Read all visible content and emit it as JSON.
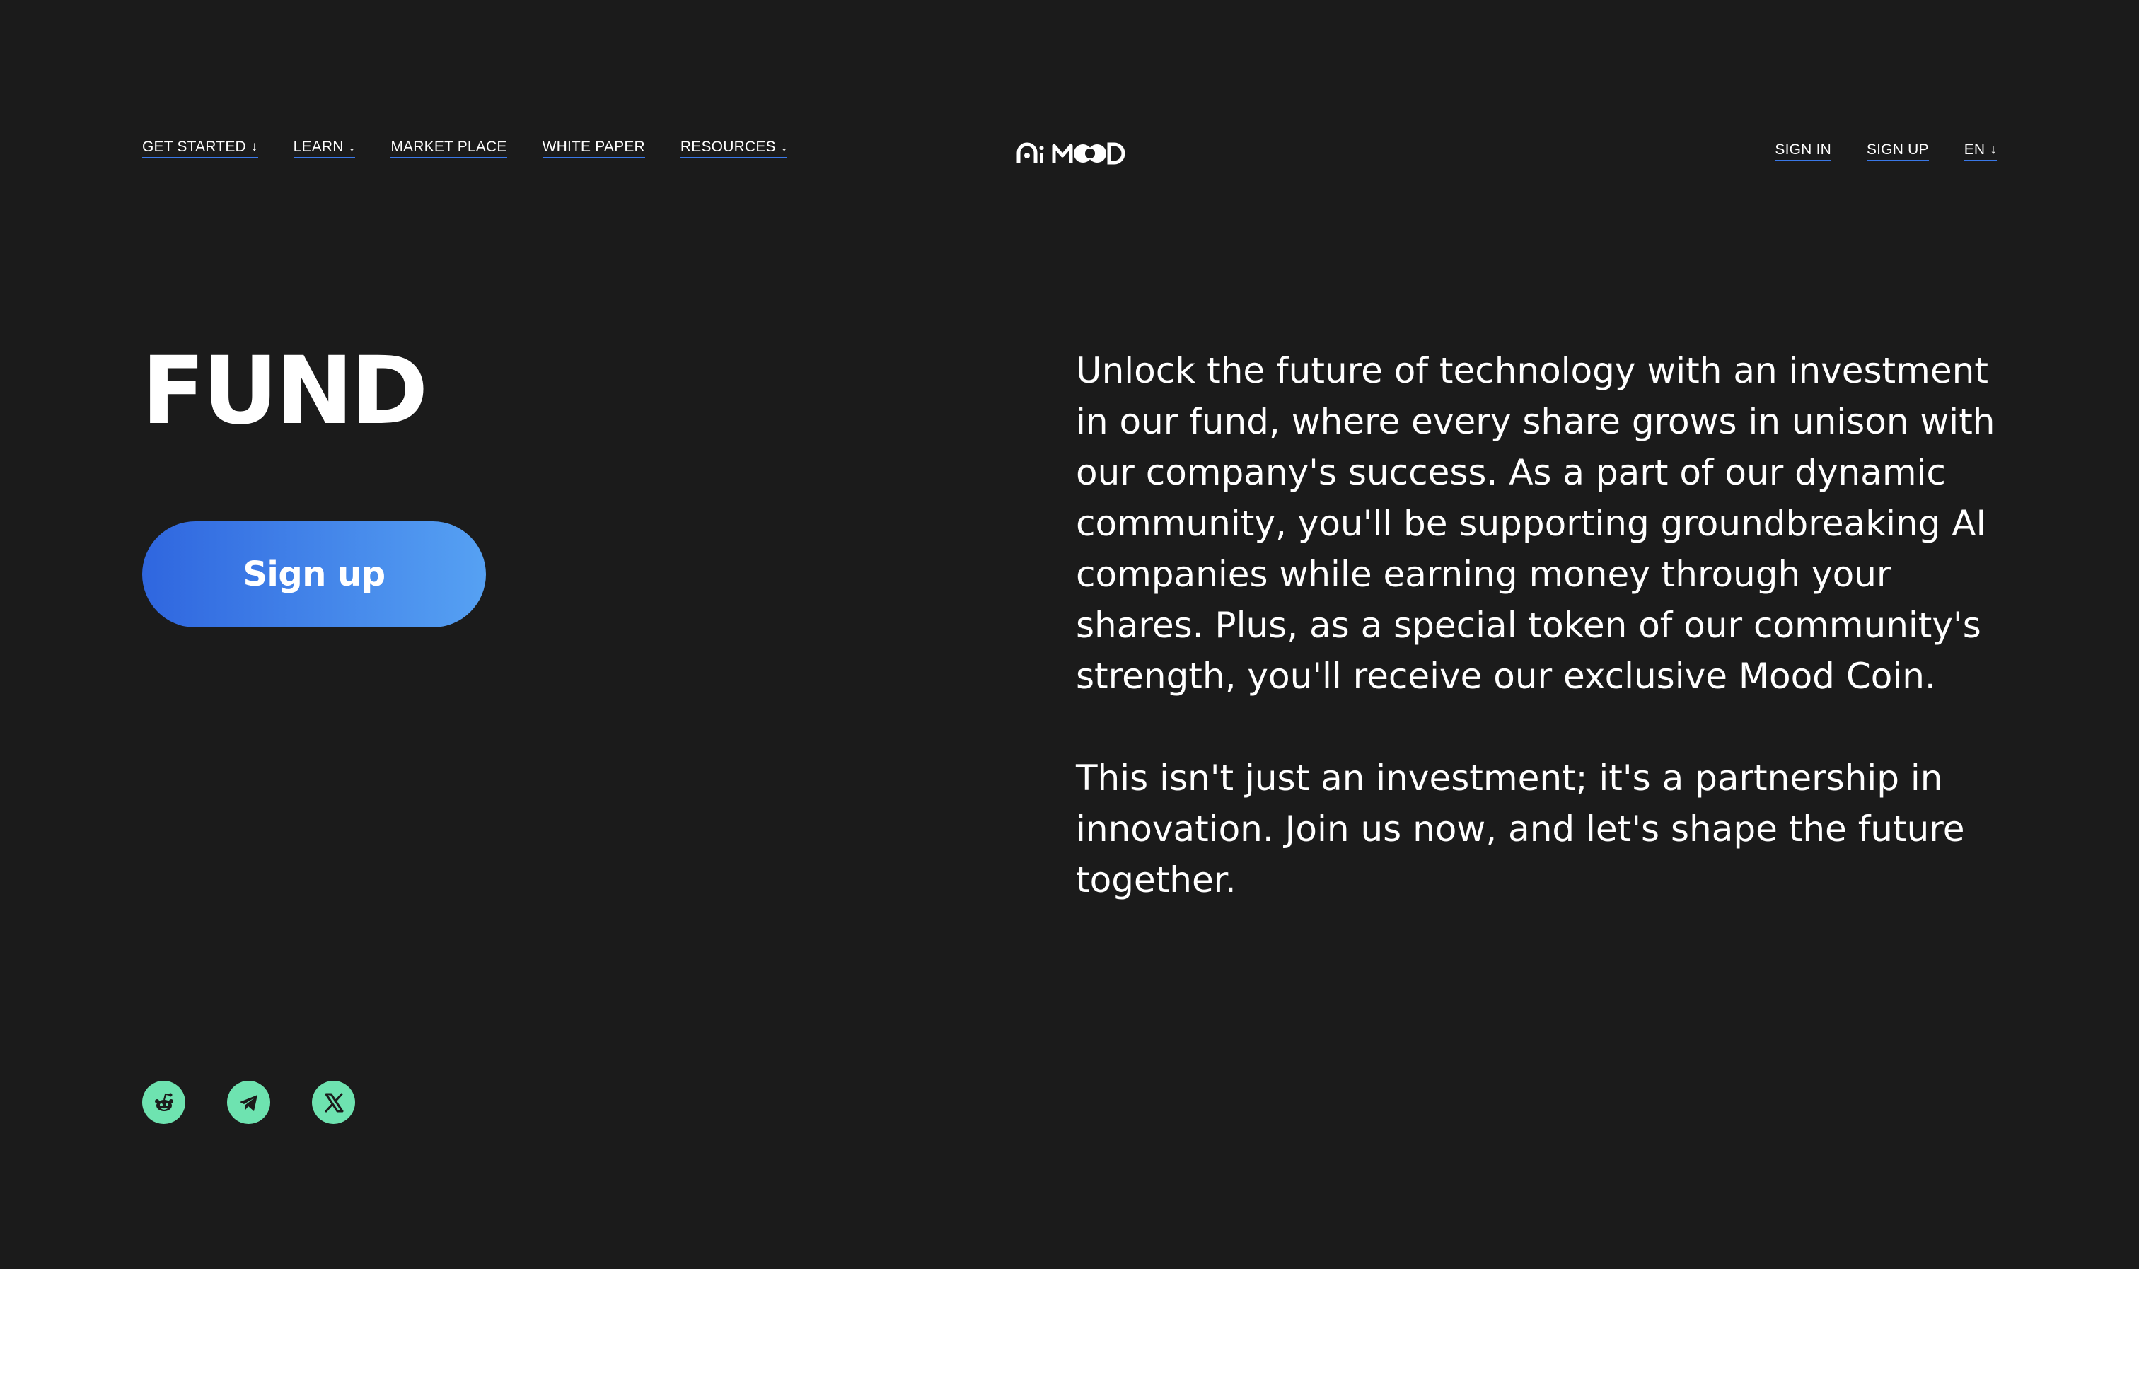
{
  "nav": {
    "left": [
      {
        "label": "GET STARTED",
        "arrow": "↓"
      },
      {
        "label": "LEARN",
        "arrow": "↓"
      },
      {
        "label": "MARKET PLACE",
        "arrow": ""
      },
      {
        "label": "WHITE PAPER",
        "arrow": ""
      },
      {
        "label": "RESOURCES",
        "arrow": "↓"
      }
    ],
    "logo_text": "Ai MOOD",
    "right": {
      "sign_in": "SIGN IN",
      "sign_up": "SIGN UP",
      "language": "EN",
      "language_arrow": "↓"
    }
  },
  "hero": {
    "title": "FUND",
    "cta_label": "Sign up",
    "paragraphs": [
      "Unlock the future of technology with an investment in our fund, where every share grows in unison with our company's success. As a part of our dynamic community, you'll be supporting groundbreaking AI companies while earning money through your shares. Plus, as a special token of our community's strength, you'll receive our exclusive Mood Coin.",
      "This isn't just an investment; it's a partnership in innovation. Join us now, and let's shape the future together."
    ]
  },
  "socials": [
    {
      "icon": "reddit-icon"
    },
    {
      "icon": "telegram-icon"
    },
    {
      "icon": "x-icon"
    }
  ],
  "colors": {
    "background": "#1b1b1b",
    "accent_underline": "#3a78e8",
    "cta_gradient_start": "#2f66df",
    "cta_gradient_end": "#56a1f3",
    "social_bg": "#6ee3b0"
  }
}
